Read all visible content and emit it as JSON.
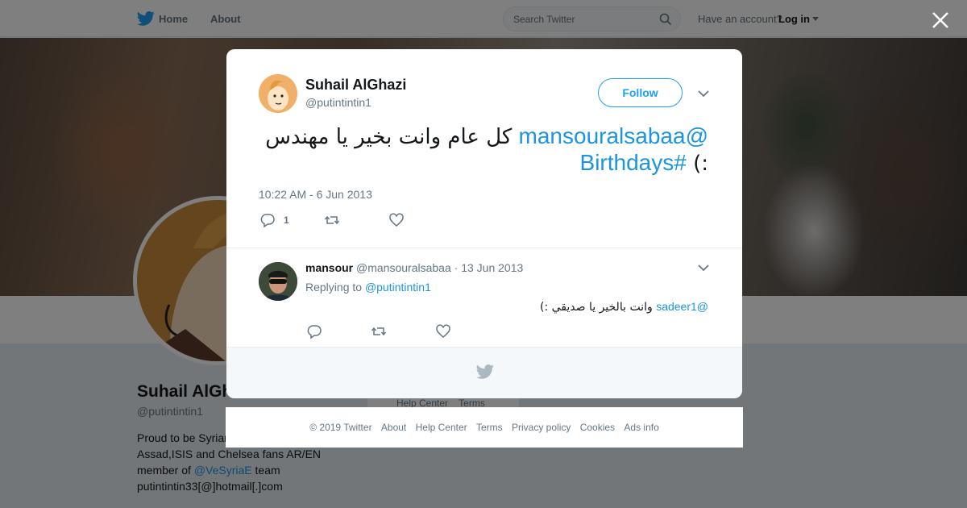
{
  "nav": {
    "home": "Home",
    "about": "About",
    "search_placeholder": "Search Twitter",
    "account_prompt": "Have an account?",
    "login": "Log in"
  },
  "profile": {
    "name": "Suhail AlGhazi",
    "handle": "@putintintin1",
    "bio_part1": "Proud to be Syrian",
    "bio_part2": "researcher,Anti Assad,ISIS and Chelsea fans AR/EN member of",
    "bio_mention": "@VeSyriaE",
    "bio_part3": "team",
    "bio_email": "putintintin33[@]hotmail[.]com"
  },
  "side_footer": {
    "help": "Help Center",
    "terms": "Terms"
  },
  "tweet": {
    "author_name": "Suhail AlGhazi",
    "author_handle": "@putintintin1",
    "follow_label": "Follow",
    "mention": "@mansouralsabaa",
    "text_arabic": "كل عام وانت بخير يا مهندس :)",
    "hashtag": "#Birthdays",
    "timestamp": "10:22 AM - 6 Jun 2013",
    "reply_count": "1"
  },
  "reply": {
    "name": "mansour",
    "handle": "@mansouralsabaa",
    "date": "· 13 Jun 2013",
    "replying_prefix": "Replying to",
    "replying_to": "@putintintin1",
    "mention": "@sadeer1",
    "text_arabic": "وانت بالخير يا صديقي :)"
  },
  "footer": {
    "copyright": "© 2019 Twitter",
    "about": "About",
    "help": "Help Center",
    "terms": "Terms",
    "privacy": "Privacy policy",
    "cookies": "Cookies",
    "ads": "Ads info"
  },
  "colors": {
    "twitter_blue": "#1da1f2",
    "link_blue": "#1b95e0",
    "muted_text": "#657786"
  },
  "icons": {
    "logo": "twitter-bird-icon",
    "search": "search-icon",
    "close": "close-icon",
    "more": "chevron-down-icon",
    "reply": "reply-icon",
    "retweet": "retweet-icon",
    "like": "heart-icon"
  }
}
